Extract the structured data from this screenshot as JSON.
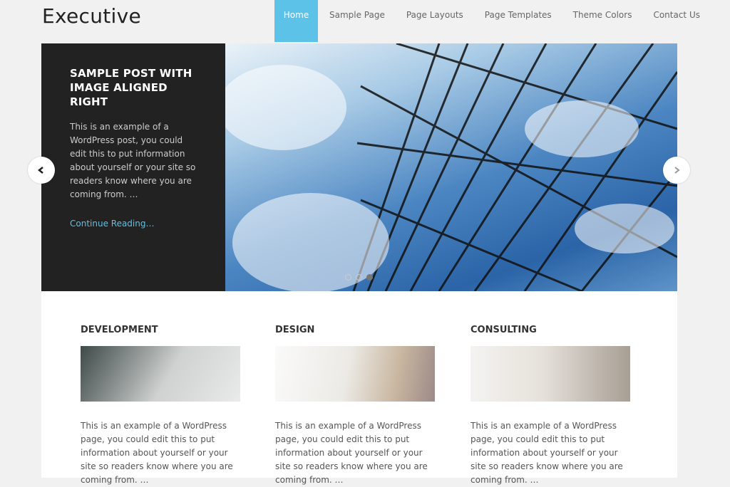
{
  "header": {
    "site_title": "Executive",
    "nav": [
      {
        "label": "Home",
        "active": true
      },
      {
        "label": "Sample Page"
      },
      {
        "label": "Page Layouts"
      },
      {
        "label": "Page Templates"
      },
      {
        "label": "Theme Colors"
      },
      {
        "label": "Contact Us"
      }
    ]
  },
  "slider": {
    "title": "SAMPLE POST WITH IMAGE ALIGNED RIGHT",
    "excerpt": "This is an example of a WordPress post, you could edit this to put information about yourself or your site so readers know where you are coming from. …",
    "link_label": "Continue Reading…",
    "prev_icon": "chevron-left-icon",
    "next_icon": "chevron-right-icon",
    "slide_count": 3,
    "active_slide": 3
  },
  "columns": [
    {
      "title": "DEVELOPMENT",
      "text": "This is an example of a WordPress page, you could edit this to put information about yourself or your site so readers know where you are coming from. …"
    },
    {
      "title": "DESIGN",
      "text": "This is an example of a WordPress page, you could edit this to put information about yourself or your site so readers know where you are coming from. …"
    },
    {
      "title": "CONSULTING",
      "text": "This is an example of a WordPress page, you could edit this to put information about yourself or your site so readers know where you are coming from. …"
    }
  ],
  "colors": {
    "accent": "#5dc2e8",
    "caption_bg": "#222222"
  }
}
